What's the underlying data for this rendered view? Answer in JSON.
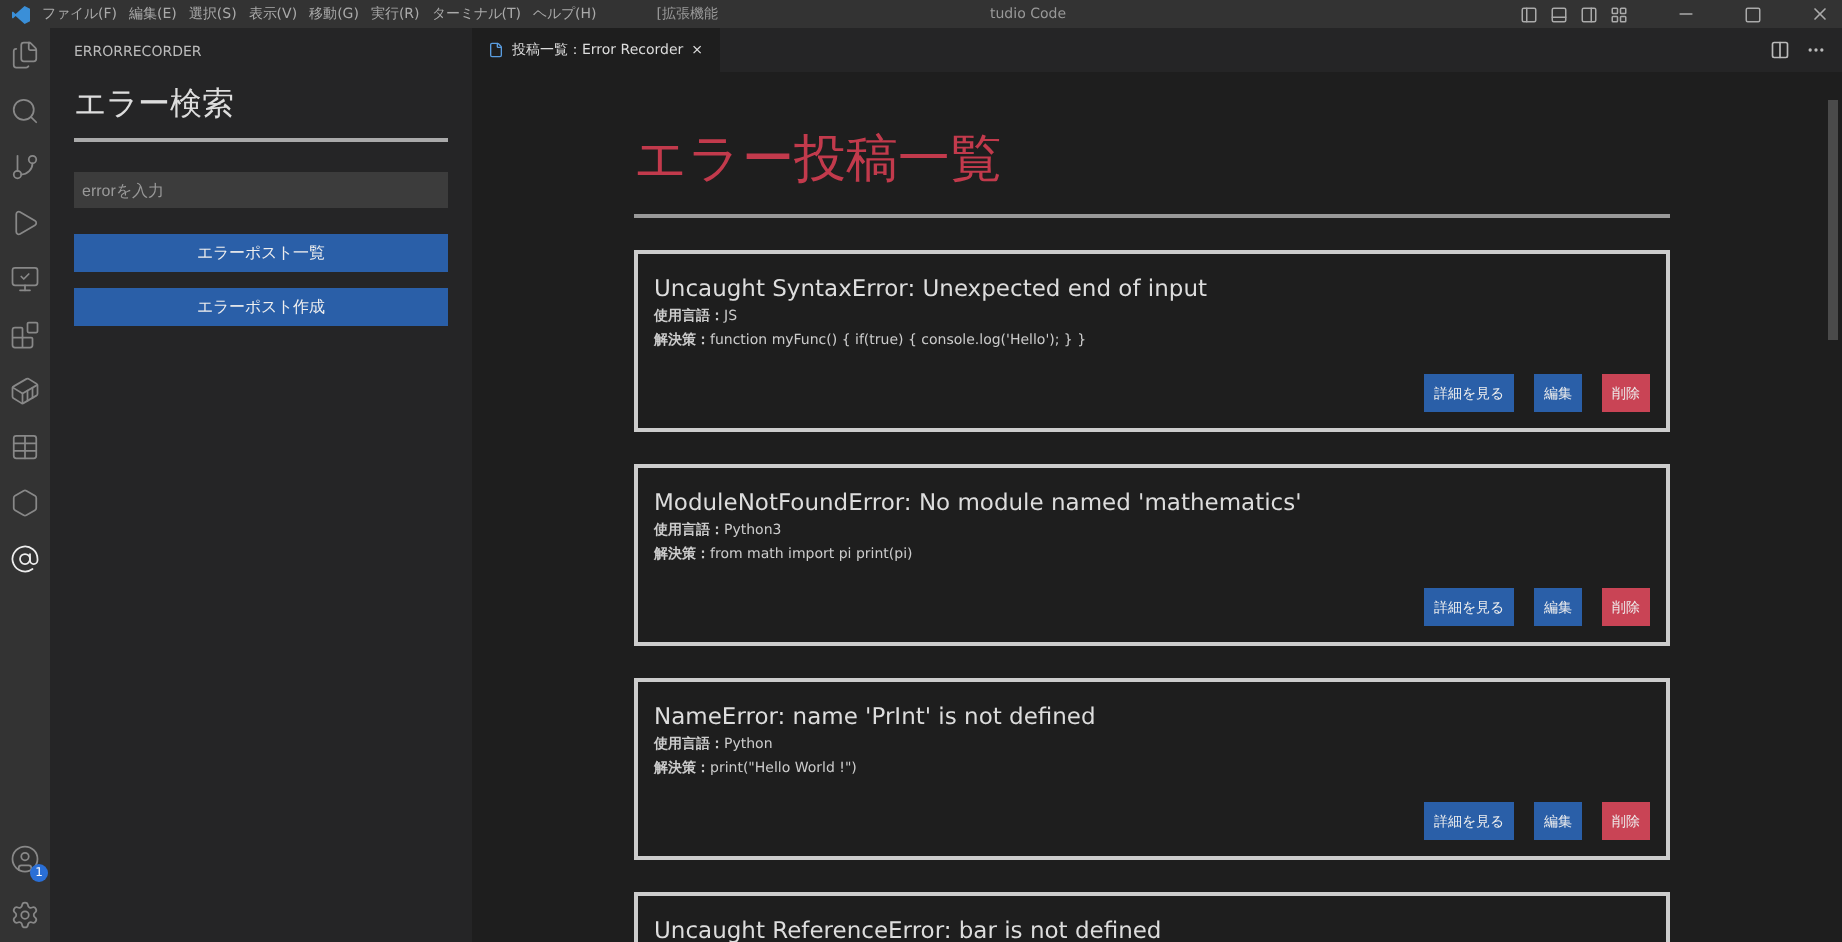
{
  "title_bar": {
    "menu": [
      "ファイル(F)",
      "編集(E)",
      "選択(S)",
      "表示(V)",
      "移動(G)",
      "実行(R)",
      "ターミナル(T)",
      "ヘルプ(H)"
    ],
    "title_start": "[拡張機能",
    "title_end": "tudio Code"
  },
  "activity_bar": {
    "account_badge": "1"
  },
  "sidebar": {
    "header": "ERRORRECORDER",
    "title": "エラー検索",
    "search": {
      "placeholder": "errorを入力"
    },
    "buttons": [
      "エラーポスト一覧",
      "エラーポスト作成"
    ]
  },
  "tabs": [
    {
      "label": "投稿一覧：Error Recorder",
      "close": "×",
      "selected": true
    }
  ],
  "page": {
    "heading": "エラー投稿一覧",
    "posts": [
      {
        "title": "Uncaught SyntaxError: Unexpected end of input",
        "language_label": "使用言語：",
        "language": "JS",
        "solution_label": "解決策：",
        "solution": "function myFunc() { if(true) { console.log('Hello'); } }",
        "actions": [
          {
            "label": "詳細を見る",
            "kind": "primary"
          },
          {
            "label": "編集",
            "kind": "primary"
          },
          {
            "label": "削除",
            "kind": "danger"
          }
        ]
      },
      {
        "title": "ModuleNotFoundError: No module named 'mathematics'",
        "language_label": "使用言語：",
        "language": "Python3",
        "solution_label": "解決策：",
        "solution": "from math import pi print(pi)",
        "actions": [
          {
            "label": "詳細を見る",
            "kind": "primary"
          },
          {
            "label": "編集",
            "kind": "primary"
          },
          {
            "label": "削除",
            "kind": "danger"
          }
        ]
      },
      {
        "title": "NameError: name 'PrInt' is not defined",
        "language_label": "使用言語：",
        "language": "Python",
        "solution_label": "解決策：",
        "solution": "print(\"Hello World !\")",
        "actions": [
          {
            "label": "詳細を見る",
            "kind": "primary"
          },
          {
            "label": "編集",
            "kind": "primary"
          },
          {
            "label": "削除",
            "kind": "danger"
          }
        ]
      },
      {
        "title": "Uncaught ReferenceError: bar is not defined"
      }
    ]
  }
}
